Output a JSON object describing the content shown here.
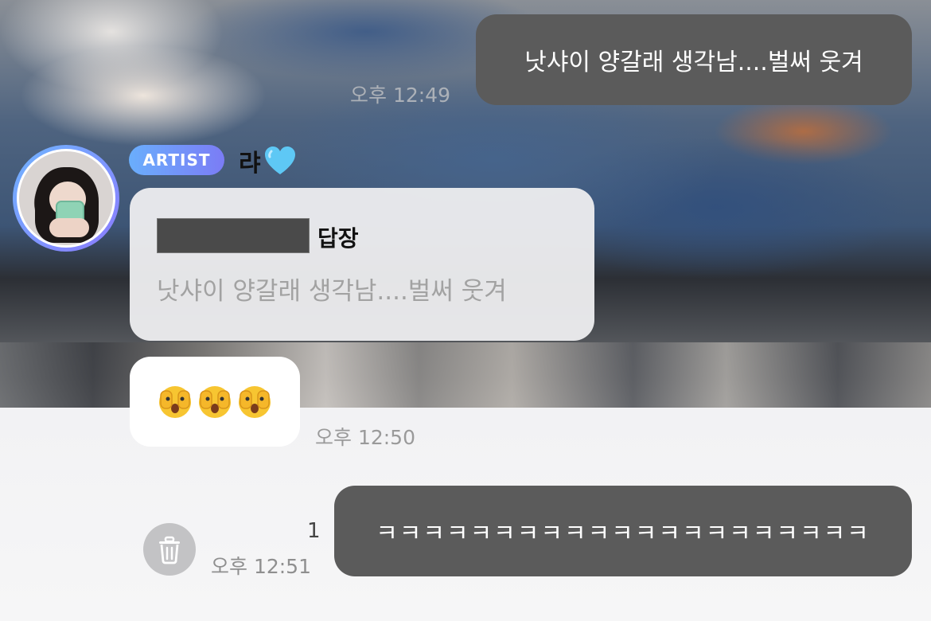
{
  "messages": {
    "sent_top": {
      "text": "낫샤이 양갈래 생각남....벌써 웃겨",
      "time": "오후 12:49"
    },
    "artist": {
      "badge": "ARTIST",
      "name": "랴",
      "name_emoji": "heart-icon",
      "reply": {
        "label": "답장",
        "quoted_text": "낫샤이 양갈래 생각남....벌써 웃겨"
      },
      "emoji_message": {
        "icons": [
          "face-hands-over-eyes-icon",
          "face-hands-over-eyes-icon",
          "face-hands-over-eyes-icon"
        ],
        "time": "오후 12:50"
      }
    },
    "sent_bottom": {
      "text": "ㅋㅋㅋㅋㅋㅋㅋㅋㅋㅋㅋㅋㅋㅋㅋㅋㅋㅋㅋㅋㅋ",
      "time": "오후 12:51",
      "unread_count": "1"
    }
  },
  "colors": {
    "sent_bubble": "#5b5b5b",
    "badge_gradient_start": "#6aaefc",
    "badge_gradient_end": "#7b7cf6",
    "heart": "#5ec8f5",
    "trash_button": "#c3c3c5"
  }
}
